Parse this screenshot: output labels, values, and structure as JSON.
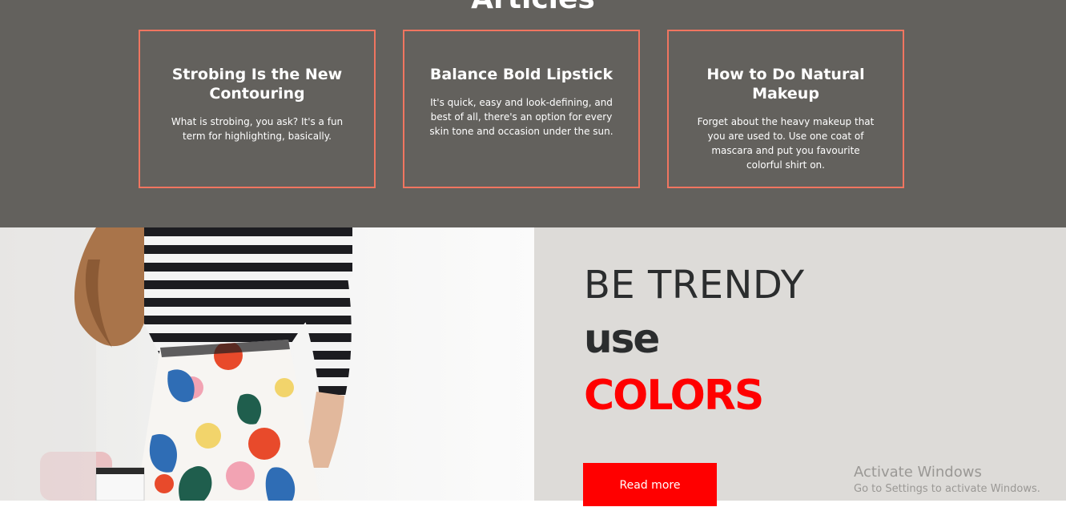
{
  "articles": {
    "title": "Articles",
    "cards": [
      {
        "title": "Strobing Is the New Contouring",
        "text": "What is strobing, you ask? It's a fun term for highlighting, basically."
      },
      {
        "title": "Balance Bold Lipstick",
        "text": "It's quick, easy and look-defining, and best of all, there's an option for every skin tone and occasion under the sun."
      },
      {
        "title": "How to Do Natural Makeup",
        "text": "Forget about the heavy makeup that you are used to. Use one coat of mascara and put you favourite colorful shirt on."
      }
    ]
  },
  "promo": {
    "headline": "BE TRENDY",
    "use": "use",
    "colors": "COLORS",
    "button_label": "Read more"
  },
  "watermark": {
    "title": "Activate Windows",
    "subtitle": "Go to Settings to activate Windows."
  },
  "colors": {
    "section_bg": "#63615d",
    "card_border": "#f07560",
    "accent_red": "#ff0000",
    "promo_bg": "#dddbd8"
  }
}
